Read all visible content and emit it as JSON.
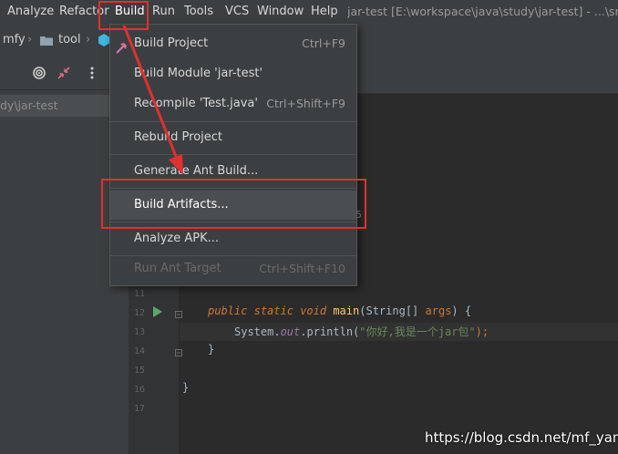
{
  "menubar": {
    "items": [
      "Analyze",
      "Refactor",
      "Build",
      "Run",
      "Tools",
      "VCS",
      "Window",
      "Help"
    ],
    "title": "jar-test [E:\\workspace\\java\\study\\jar-test] - ...\\src\\c"
  },
  "navbar": {
    "crumbs": [
      "mfy",
      "tool"
    ]
  },
  "left_panel": {
    "path": "dy\\jar-test"
  },
  "build_menu": {
    "items": [
      {
        "label": "Build Project",
        "shortcut": "Ctrl+F9"
      },
      {
        "label": "Build Module 'jar-test'",
        "shortcut": ""
      },
      {
        "label": "Recompile 'Test.java'",
        "shortcut": "Ctrl+Shift+F9"
      },
      {
        "label": "Rebuild Project",
        "shortcut": ""
      },
      {
        "label": "Generate Ant Build...",
        "shortcut": ""
      },
      {
        "label": "Build Artifacts...",
        "shortcut": ""
      },
      {
        "label": "Analyze APK...",
        "shortcut": ""
      },
      {
        "label": "Run Ant Target",
        "shortcut": "Ctrl+Shift+F10"
      }
    ],
    "peek_char": "5"
  },
  "editor": {
    "line_numbers": [
      "11",
      "12",
      "13",
      "14",
      "15",
      "16",
      "17"
    ],
    "code": {
      "kw1": "public",
      "kw2": "static",
      "kw3": "void",
      "method": "main",
      "paren_open": "(",
      "type": "String",
      "brackets": "[]",
      "param": "args",
      "paren_close": ")",
      "brace_open": "{",
      "sys": "System.",
      "out": "out",
      "dot_println": ".println(",
      "string": "\"你好,我是一个jar包\"",
      "end": ");",
      "brace_close_inner": "}",
      "brace_close_outer": "}"
    }
  },
  "watermark": "https://blog.csdn.net/mf_yang",
  "colors": {
    "accent_red": "#e03030",
    "keyword": "#cc7832",
    "string": "#6a8759",
    "method": "#ffc66d",
    "field": "#9876aa"
  }
}
